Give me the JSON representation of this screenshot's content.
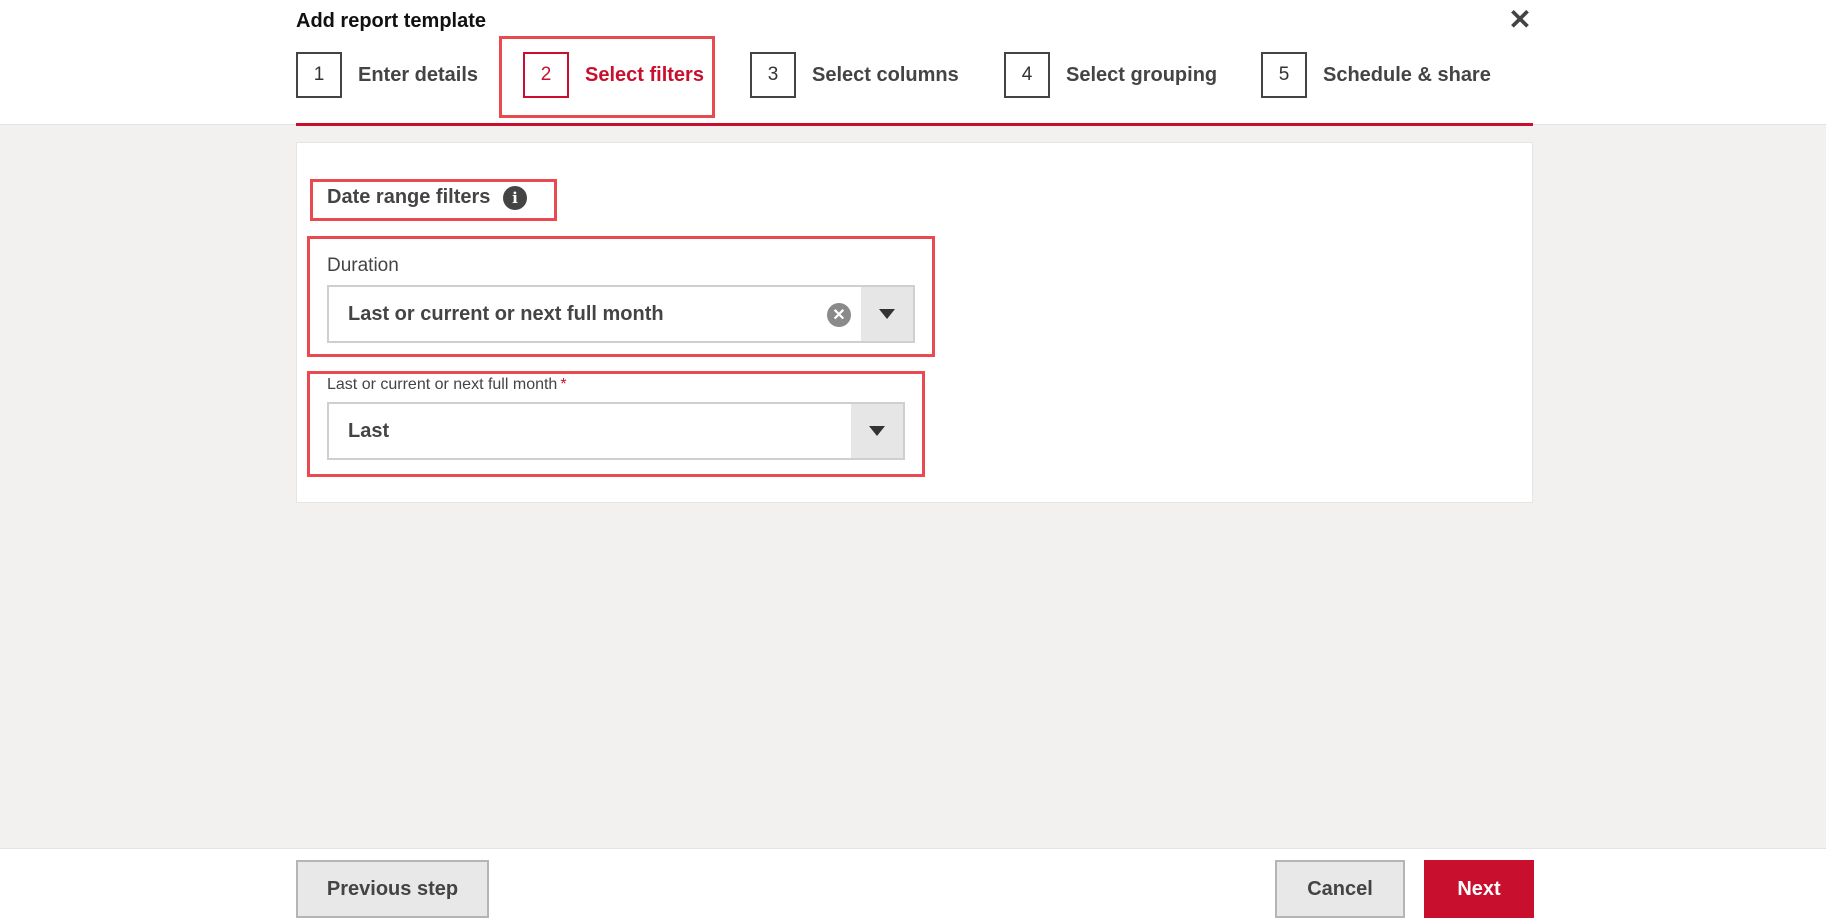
{
  "dialog": {
    "title": "Add report template",
    "close_icon": "close-icon"
  },
  "steps": [
    {
      "num": "1",
      "label": "Enter details"
    },
    {
      "num": "2",
      "label": "Select filters",
      "active": true
    },
    {
      "num": "3",
      "label": "Select columns"
    },
    {
      "num": "4",
      "label": "Select grouping"
    },
    {
      "num": "5",
      "label": "Schedule & share"
    }
  ],
  "filters": {
    "section_title": "Date range filters",
    "info_icon": "info-icon",
    "duration": {
      "label": "Duration",
      "value": "Last or current or next full month"
    },
    "month": {
      "label": "Last or current or next full month",
      "required_mark": "*",
      "value": "Last"
    }
  },
  "footer": {
    "previous": "Previous step",
    "cancel": "Cancel",
    "next": "Next"
  },
  "colors": {
    "accent": "#c8102e",
    "highlight": "#e84a4f"
  }
}
